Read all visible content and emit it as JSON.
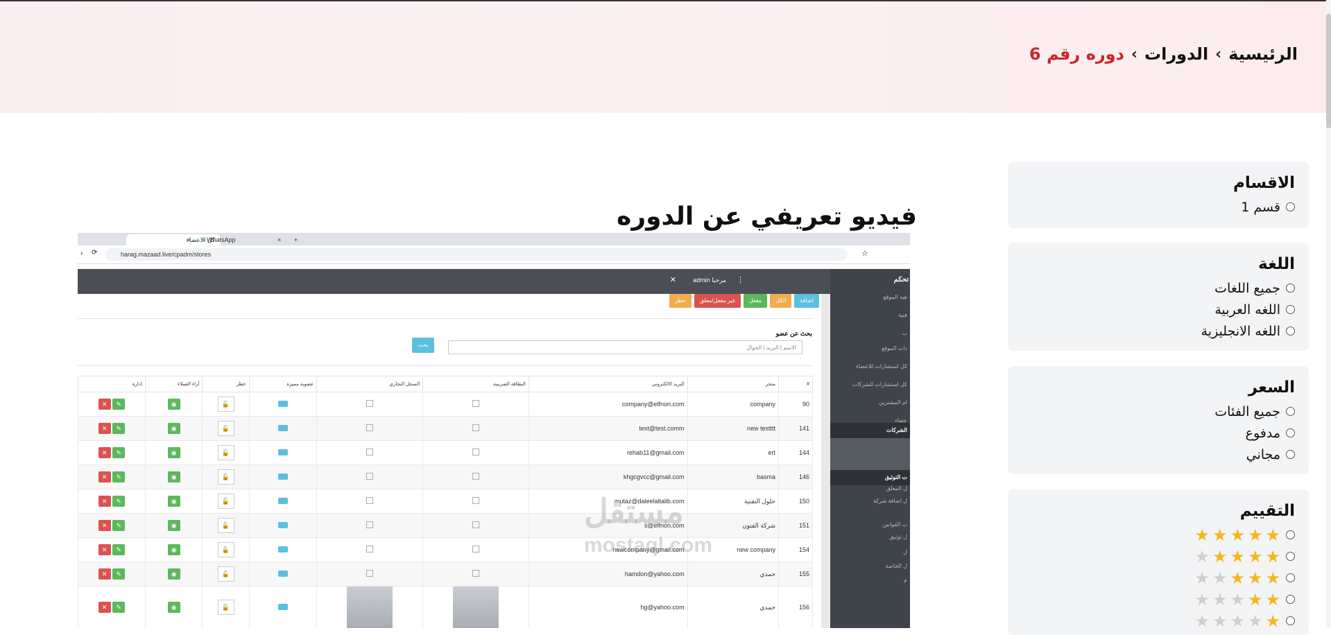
{
  "breadcrumb": {
    "home": "الرئيسية",
    "courses": "الدورات",
    "current": "دوره رقم 6",
    "separator": "›"
  },
  "filters": {
    "sections": {
      "title": "الاقسام",
      "options": [
        "قسم 1"
      ]
    },
    "language": {
      "title": "اللغة",
      "options": [
        "جميع اللغات",
        "اللغه العربية",
        "اللغه الانجليزية"
      ]
    },
    "price": {
      "title": "السعر",
      "options": [
        "جميع الفئات",
        "مدفوع",
        "مجاني"
      ]
    },
    "rating": {
      "title": "التقييم",
      "levels": [
        5,
        4,
        3,
        2,
        1
      ]
    }
  },
  "video": {
    "title": "فيديو تعريفي عن الدوره",
    "browser": {
      "tab1": "كل الاعضاء",
      "tab2": "WhatsApp",
      "url": "harag.mazaad.live/cpadm/stores"
    },
    "admin_bar": "admin مرحبا",
    "sidebar_title": "تحكم",
    "sidebar_items": [
      "هية الموقع",
      "فنية",
      "ب",
      "دات الموقع",
      "كل استشارات للاعضاء",
      "كل استشارات للشركات",
      "ام المشترين",
      "عضاء",
      "ل المعلق",
      "ل اضافة شركة",
      "ب القوانين",
      "ل توثيق",
      "ل",
      "ل الخاصة",
      "م"
    ],
    "sidebar_section": "الشركات",
    "sidebar_section2": "ت التوثيق",
    "action_buttons": [
      "اضافة",
      "الكل",
      "مفعل",
      "غير مفعل/معلق",
      "حظر"
    ],
    "search_label": "بحث عن عضو",
    "search_placeholder": "الاسم | البريد | الجوال",
    "search_button": "بحث",
    "table_headers": [
      "#",
      "متجر",
      "البريد الالكتروني",
      "البطاقة الضريبية",
      "السجل التجاري",
      "عضوية مميزة",
      "حظر",
      "آراء العملاء",
      "ادارة"
    ],
    "rows": [
      {
        "id": "90",
        "store": "company",
        "email": "company@elfnon.com"
      },
      {
        "id": "141",
        "store": "new testttt",
        "email": "test@test.comm"
      },
      {
        "id": "144",
        "store": "ert",
        "email": "rehab11@gmail.com"
      },
      {
        "id": "146",
        "store": "basma",
        "email": "khgcgvcc@gmail.com"
      },
      {
        "id": "150",
        "store": "حلول التقنية",
        "email": "mutaz@daleelaltalib.com"
      },
      {
        "id": "151",
        "store": "شركة الفنون",
        "email": "s@elfnon.com"
      },
      {
        "id": "154",
        "store": "new company",
        "email": "newcompany@gmail.com"
      },
      {
        "id": "155",
        "store": "حمدي",
        "email": "hamdon@yahoo.com"
      },
      {
        "id": "156",
        "store": "حمدي",
        "email": "hg@yahoo.com"
      }
    ],
    "watermark_ar": "مستقل",
    "watermark_en": "mostaql.com"
  },
  "colors": {
    "accent": "#c8282c",
    "star": "#f5b81b",
    "panel": "#f3f4f6"
  }
}
